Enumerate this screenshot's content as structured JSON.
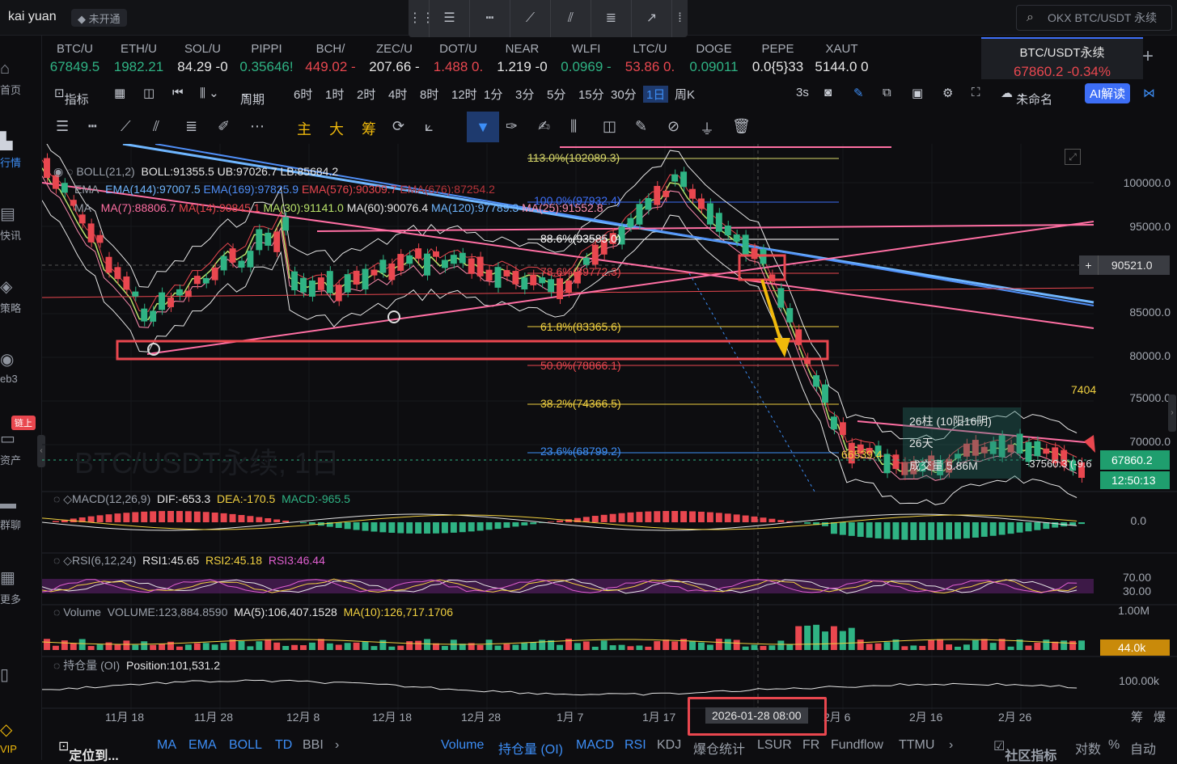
{
  "header": {
    "user": "kai yuan",
    "badge": "未开通",
    "search_placeholder": "OKX BTC/USDT 永续"
  },
  "nav": [
    {
      "label": "首页",
      "icon": "home-icon"
    },
    {
      "label": "行情",
      "icon": "chart-icon",
      "active": true
    },
    {
      "label": "快讯",
      "icon": "news-icon"
    },
    {
      "label": "策略",
      "icon": "strategy-icon"
    },
    {
      "label": "eb3",
      "icon": "web3-icon"
    },
    {
      "label": "资产",
      "icon": "wallet-icon",
      "tag": "链上"
    },
    {
      "label": "群聊",
      "icon": "chat-icon"
    },
    {
      "label": "更多",
      "icon": "more-icon"
    },
    {
      "label": "VIP",
      "icon": "vip-icon"
    }
  ],
  "tickers": [
    {
      "name": "BTC/U",
      "price": "67849.5",
      "dir": "up"
    },
    {
      "name": "ETH/U",
      "price": "1982.21",
      "dir": "up"
    },
    {
      "name": "SOL/U",
      "price": "84.29 -0",
      "dir": "flat"
    },
    {
      "name": "PIPPI",
      "price": "0.35646!",
      "dir": "up"
    },
    {
      "name": "BCH/",
      "price": "449.02 -",
      "dir": "dn"
    },
    {
      "name": "ZEC/U",
      "price": "207.66 -",
      "dir": "flat"
    },
    {
      "name": "DOT/U",
      "price": "1.488 0.",
      "dir": "dn"
    },
    {
      "name": "NEAR",
      "price": "1.219 -0",
      "dir": "flat"
    },
    {
      "name": "WLFI",
      "price": "0.0969 -",
      "dir": "up"
    },
    {
      "name": "LTC/U",
      "price": "53.86 0.",
      "dir": "dn"
    },
    {
      "name": "DOGE",
      "price": "0.09011",
      "dir": "up"
    },
    {
      "name": "PEPE",
      "price": "0.0{5}33",
      "dir": "flat"
    },
    {
      "name": "XAUT",
      "price": "5144.0 0",
      "dir": "flat"
    },
    {
      "name": "BTC/USDT永续",
      "price": "67860.2 -0.34%",
      "dir": "dn",
      "active": true
    }
  ],
  "toolbar": {
    "indicator": "指标",
    "period": "周期",
    "intervals": [
      "6时",
      "1时",
      "2时",
      "4时",
      "8时",
      "12时",
      "1分",
      "3分",
      "5分",
      "15分",
      "30分",
      "1日",
      "周K"
    ],
    "active_interval": "1日",
    "refresh": "3s",
    "layout_name": "未命名",
    "ai_label": "AI解读"
  },
  "drawbar": {
    "main": "主",
    "big": "大",
    "chip": "筹"
  },
  "legend": {
    "boll": "BOLL(21,2)",
    "boll_vals": "BOLL:91355.5  UB:97026.7  LB:85684.2",
    "ema_label": "EMA",
    "ema144": "EMA(144):97007.5",
    "ema169": "EMA(169):97825.9",
    "ema576": "EMA(576):90309.7",
    "ema676": "EMA(676):87254.2",
    "ma_label": "MA",
    "ma7": "MA(7):88806.7",
    "ma14": "MA(14):90845.1",
    "ma30": "MA(30):91141.0",
    "ma60": "MA(60):90076.4",
    "ma120": "MA(120):97789.3",
    "ma25": "MA(25):91552.8"
  },
  "fib": [
    {
      "label": "113.0%(102089.3)",
      "color": "#d9d96a"
    },
    {
      "label": "100.0%(97932.4)",
      "color": "#3d6ef6"
    },
    {
      "label": "88.6%(93585.0)",
      "color": "#ffffff"
    },
    {
      "label": "78.6%(89772.3)",
      "color": "#e9474f"
    },
    {
      "label": "61.8%(83365.6)",
      "color": "#f0d040"
    },
    {
      "label": "50.0%(78866.1)",
      "color": "#e9474f"
    },
    {
      "label": "38.2%(74366.5)",
      "color": "#f0d040"
    },
    {
      "label": "23.6%(68799.2)",
      "color": "#3d8ef6"
    }
  ],
  "price_axis": [
    "100000.0",
    "95000.0",
    "90521.0",
    "85000.0",
    "80000.0",
    "75000.0",
    "70000.0"
  ],
  "current_price": "67860.2",
  "countdown": "12:50:13",
  "annot": {
    "high": "7404",
    "low": "66539.4",
    "bars": "26柱 (10阳16阴)",
    "days": "26天",
    "volume": "成交量 5.86M",
    "delta": "-37560.3 (-9.6"
  },
  "watermark": "BTC/USDT永续, 1日",
  "macd": {
    "name": "MACD(12,26,9)",
    "dif": "DIF:-653.3",
    "dea": "DEA:-170.5",
    "macd": "MACD:-965.5",
    "zero": "0.0"
  },
  "rsi": {
    "name": "RSI(6,12,24)",
    "r1": "RSI1:45.65",
    "r2": "RSI2:45.18",
    "r3": "RSI3:46.44",
    "l70": "70.00",
    "l30": "30.00"
  },
  "volume": {
    "name": "Volume",
    "vol": "VOLUME:123,884.8590",
    "ma5": "MA(5):106,407.1528",
    "ma10": "MA(10):126,717.1706",
    "axis": "1.00M",
    "cur": "44.0k"
  },
  "oi": {
    "name": "持仓量 (OI)",
    "pos": "Position:101,531.2",
    "axis": "100.00k"
  },
  "dates": [
    "11月 18",
    "11月 28",
    "12月 8",
    "12月 18",
    "12月 28",
    "1月 7",
    "1月 17",
    "2026-01-28 08:00",
    "2月 6",
    "2月 16",
    "2月 26"
  ],
  "corner": [
    "筹",
    "爆"
  ],
  "bottombar": {
    "goto": "定位到...",
    "left": [
      "MA",
      "EMA",
      "BOLL",
      "TD",
      "BBI"
    ],
    "right": [
      "Volume",
      "持仓量 (OI)",
      "MACD",
      "RSI",
      "KDJ",
      "爆仓统计",
      "LSUR",
      "FR",
      "Fundflow",
      "TTMU"
    ],
    "community": "社区指标",
    "log": "对数",
    "pct": "%",
    "auto": "自动"
  }
}
